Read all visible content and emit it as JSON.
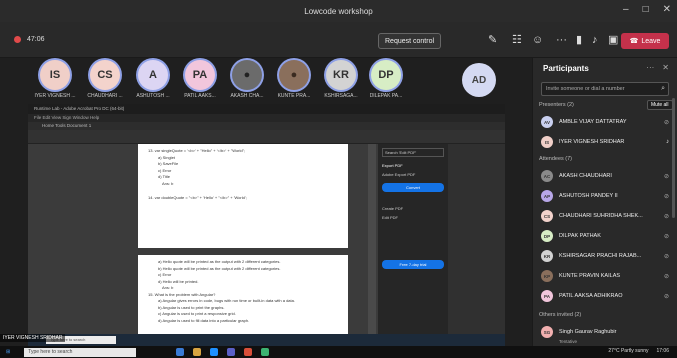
{
  "window": {
    "title": "Lowcode workshop",
    "controls": [
      "–",
      "□",
      "✕"
    ]
  },
  "toolbar": {
    "timer": "47:06",
    "request_control": "Request control",
    "more": "···",
    "leave": "Leave"
  },
  "strip": {
    "participants": [
      {
        "initials": "IS",
        "name": "IYER VIGNESH ...",
        "color": "#f0cfc8"
      },
      {
        "initials": "CS",
        "name": "CHAUDHARI ...",
        "color": "#f3d3cc"
      },
      {
        "initials": "A",
        "name": "ASHUTOSH ...",
        "color": "#dcd5f3"
      },
      {
        "initials": "PA",
        "name": "PATIL AAKS...",
        "color": "#f2c6dc"
      },
      {
        "initials": "",
        "name": "AKASH CHA...",
        "color": "#6b6b6b"
      },
      {
        "initials": "",
        "name": "KUNTE PRA...",
        "color": "#8a6f5c"
      },
      {
        "initials": "KR",
        "name": "KSHIRSAGA...",
        "color": "#d3d3d3"
      },
      {
        "initials": "DP",
        "name": "DILEPAK PA...",
        "color": "#d7edc5"
      }
    ],
    "self_initials": "AD"
  },
  "shared_screen": {
    "acrobat_title": "Runtime Lab - Adobe Acrobat Pro DC (64-bit)",
    "menu": "File  Edit  View  Sign  Window  Help",
    "tabs": "Home    Tools    Document 1",
    "page1_lines": [
      "13. var singleQuote = '<b>' + \"Hello\" + '</b>' + \"World\";",
      "a) Singlet",
      "b) SaveFile",
      "c) Error",
      "d) Title",
      "Ans: b",
      "14. var doubleQuote = \"<b>\" + 'Hello' + \"</b>\" + 'World';"
    ],
    "page2_lines": [
      "a) Hello quote will be printed as the output with 2 different categories.",
      "b) Hello quote will be printed as the output with 2 different categories.",
      "c) Error",
      "d) Hello will be printed.",
      "Ans: b",
      "15. What is the problem with Angular?",
      "a) Angular gives errors in code, bugs with run time or built-in data with a data.",
      "b) Angular is used to print the graphs.",
      "c) Angular is used to print a responsive grid.",
      "d) Angular is used to fill data into a particular graph.",
      "Ans: a"
    ],
    "panel": {
      "search": "Search 'Edit PDF'",
      "export": "Export PDF",
      "export_desc": "Adobe Export PDF",
      "convert": "Convert",
      "create": "Create PDF",
      "edit": "Edit PDF",
      "start_trial": "Free 7-day trial"
    },
    "search_placeholder": "Type here to search",
    "presenter": "IYER VIGNESH SRIDHAR"
  },
  "participants_pane": {
    "title": "Participants",
    "invite_placeholder": "Invite someone or dial a number",
    "presenters_header": "Presenters (2)",
    "mute_all": "Mute all",
    "presenters": [
      {
        "initials": "AV",
        "name": "AMBLE VIJAY DATTATRAY",
        "color": "#c9d0f0"
      },
      {
        "initials": "IS",
        "name": "IYER VIGNESH SRIDHAR",
        "color": "#f0cfc8"
      }
    ],
    "attendees_header": "Attendees (7)",
    "attendees": [
      {
        "initials": "AC",
        "name": "AKASH CHAUDHARI",
        "color": "#8a8a8a"
      },
      {
        "initials": "AP",
        "name": "ASHUTOSH PANDEY II",
        "color": "#b8a7e8"
      },
      {
        "initials": "CS",
        "name": "CHAUDHARI SUHRIDHA SHEK...",
        "color": "#f3d3cc"
      },
      {
        "initials": "DP",
        "name": "DILPAK PATHAK",
        "color": "#d7edc5"
      },
      {
        "initials": "KR",
        "name": "KSHIRSAGAR PRACHI RAJAB...",
        "color": "#d3d3d3"
      },
      {
        "initials": "KP",
        "name": "KUNTE PRAVIN KAILAS",
        "color": "#8a6f5c"
      },
      {
        "initials": "PA",
        "name": "PATIL AAKSA ADHIKRAO",
        "color": "#f2c6dc"
      }
    ],
    "others_header": "Others invited (2)",
    "others": [
      {
        "initials": "SG",
        "name": "Singh Gaurav Raghubir",
        "sub": "Tentative",
        "color": "#f2b0b0"
      }
    ]
  },
  "taskbar": {
    "search": "Type here to search",
    "weather": "27°C  Partly sunny",
    "time": "17:06"
  }
}
